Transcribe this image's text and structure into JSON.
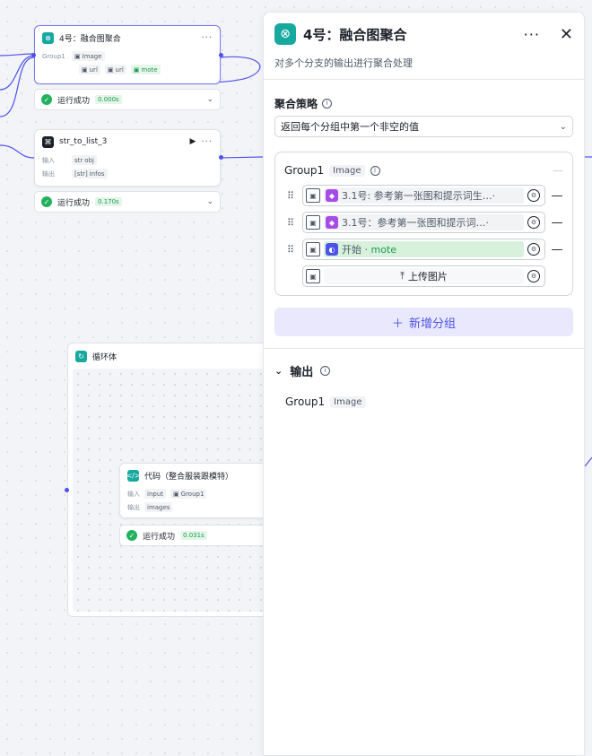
{
  "canvas": {
    "node_merge": {
      "title": "4号：融合图聚合",
      "row_label": "Group1",
      "row_type": "Image",
      "tags": [
        "url",
        "url",
        "mote"
      ]
    },
    "status_merge": {
      "label": "运行成功",
      "time": "0.000s"
    },
    "node_str": {
      "title": "str_to_list_3",
      "input_label": "输入",
      "input_tag": "obj",
      "input_type": "str",
      "output_label": "输出",
      "output_tag": "infos",
      "output_type": "[str]"
    },
    "status_str": {
      "label": "运行成功",
      "time": "0.170s"
    },
    "loop": {
      "title": "循环体"
    },
    "node_code": {
      "title": "代码（整合服装跟模特）",
      "input_label": "输入",
      "input_tags": [
        "input",
        "Group1"
      ],
      "output_label": "输出",
      "output_tag": "images"
    },
    "status_code": {
      "label": "运行成功",
      "time": "0.031s"
    }
  },
  "panel": {
    "title": "4号：融合图聚合",
    "description": "对多个分支的输出进行聚合处理",
    "strategy_label": "聚合策略",
    "strategy_value": "返回每个分组中第一个非空的值",
    "group": {
      "name": "Group1",
      "type": "Image",
      "items": [
        {
          "text": "3.1号: 参考第一张图和提示词生…·",
          "highlight": ""
        },
        {
          "text": "3.1号：参考第一张图和提示词…·",
          "highlight": ""
        },
        {
          "text": "开始 · ",
          "highlight": "mote"
        }
      ],
      "upload_label": "上传图片"
    },
    "add_group_label": "新增分组",
    "output_label": "输出",
    "output_group": "Group1",
    "output_type": "Image"
  },
  "colors": {
    "accent": "#4d53e8",
    "teal": "#17a8a0",
    "success": "#23b15e",
    "purple": "#a64de6"
  }
}
